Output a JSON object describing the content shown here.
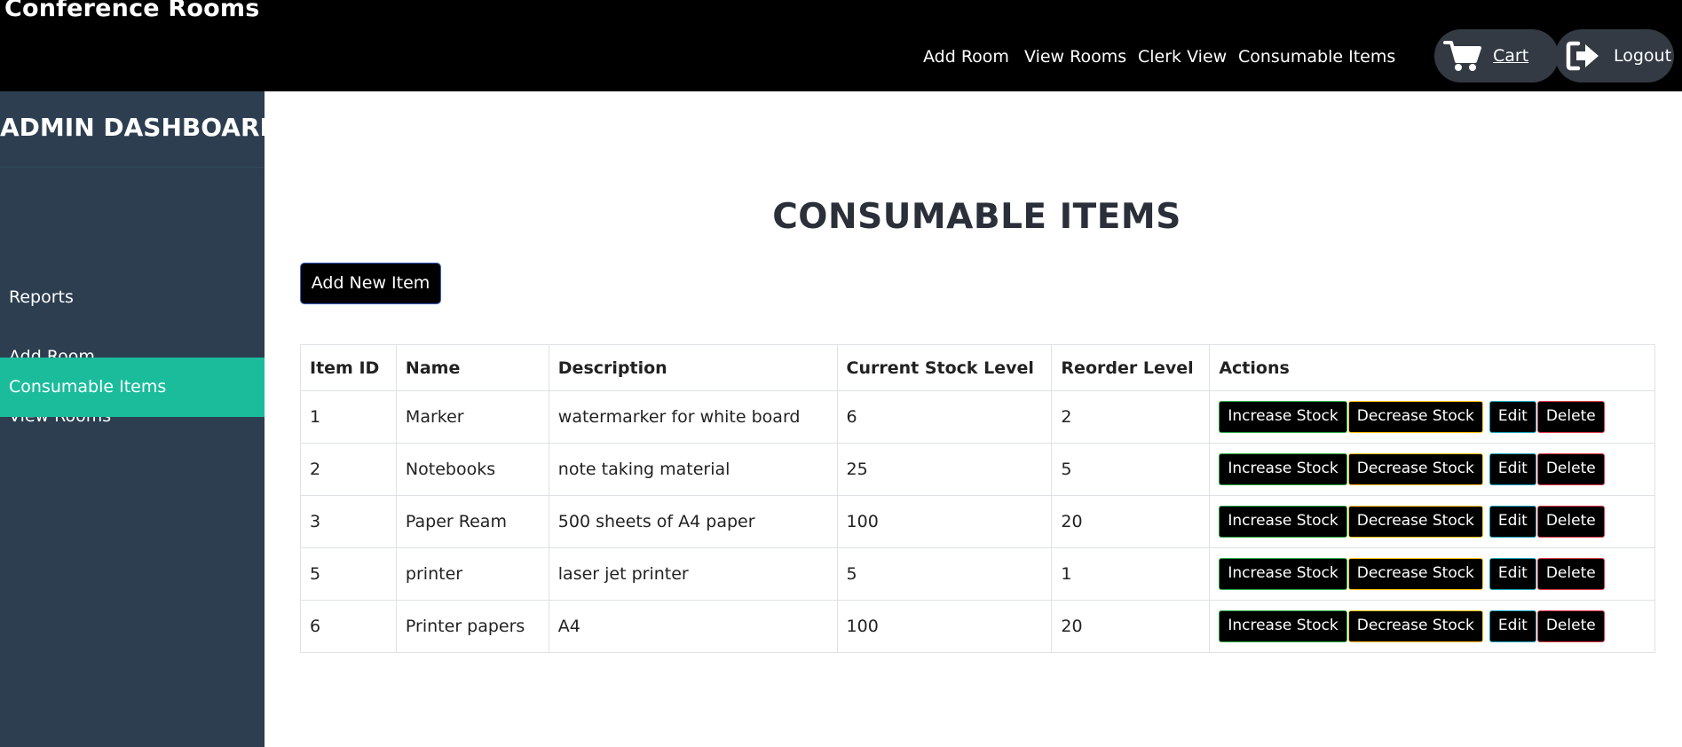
{
  "header": {
    "brand": "Conference Rooms",
    "nav": [
      "Add Room",
      "View Rooms",
      "Clerk View",
      "Consumable Items"
    ],
    "cart_label": "Cart",
    "logout_label": "Logout",
    "cart_icon": "cart-icon",
    "logout_icon": "sign-out-icon"
  },
  "sidebar": {
    "title": "ADMIN DASHBOARD",
    "items": [
      {
        "label": "Reports",
        "active": false
      },
      {
        "label": "Add Room",
        "active": false
      },
      {
        "label": "View Rooms",
        "active": false
      },
      {
        "label": "Consumable Items",
        "active": true
      }
    ]
  },
  "main": {
    "title": "CONSUMABLE ITEMS",
    "add_button": "Add New Item",
    "table": {
      "headers": [
        "Item ID",
        "Name",
        "Description",
        "Current Stock Level",
        "Reorder Level",
        "Actions"
      ],
      "rows": [
        [
          "1",
          "Marker",
          "watermarker for white board",
          "6",
          "2"
        ],
        [
          "2",
          "Notebooks",
          "note taking material",
          "25",
          "5"
        ],
        [
          "3",
          "Paper Ream",
          "500 sheets of A4 paper",
          "100",
          "20"
        ],
        [
          "5",
          "printer",
          "laser jet printer",
          "5",
          "1"
        ],
        [
          "6",
          "Printer papers",
          "A4",
          "100",
          "20"
        ]
      ],
      "actions": {
        "increase": "Increase Stock",
        "decrease": "Decrease Stock",
        "edit": "Edit",
        "delete": "Delete"
      }
    }
  },
  "colors": {
    "topbar": "#000000",
    "sidebar": "#2c3e50",
    "sidebar_active": "#1abc9c",
    "increase_border": "#28a745",
    "decrease_border": "#ffc107",
    "edit_border": "#17a2b8",
    "delete_border": "#dc3545"
  }
}
